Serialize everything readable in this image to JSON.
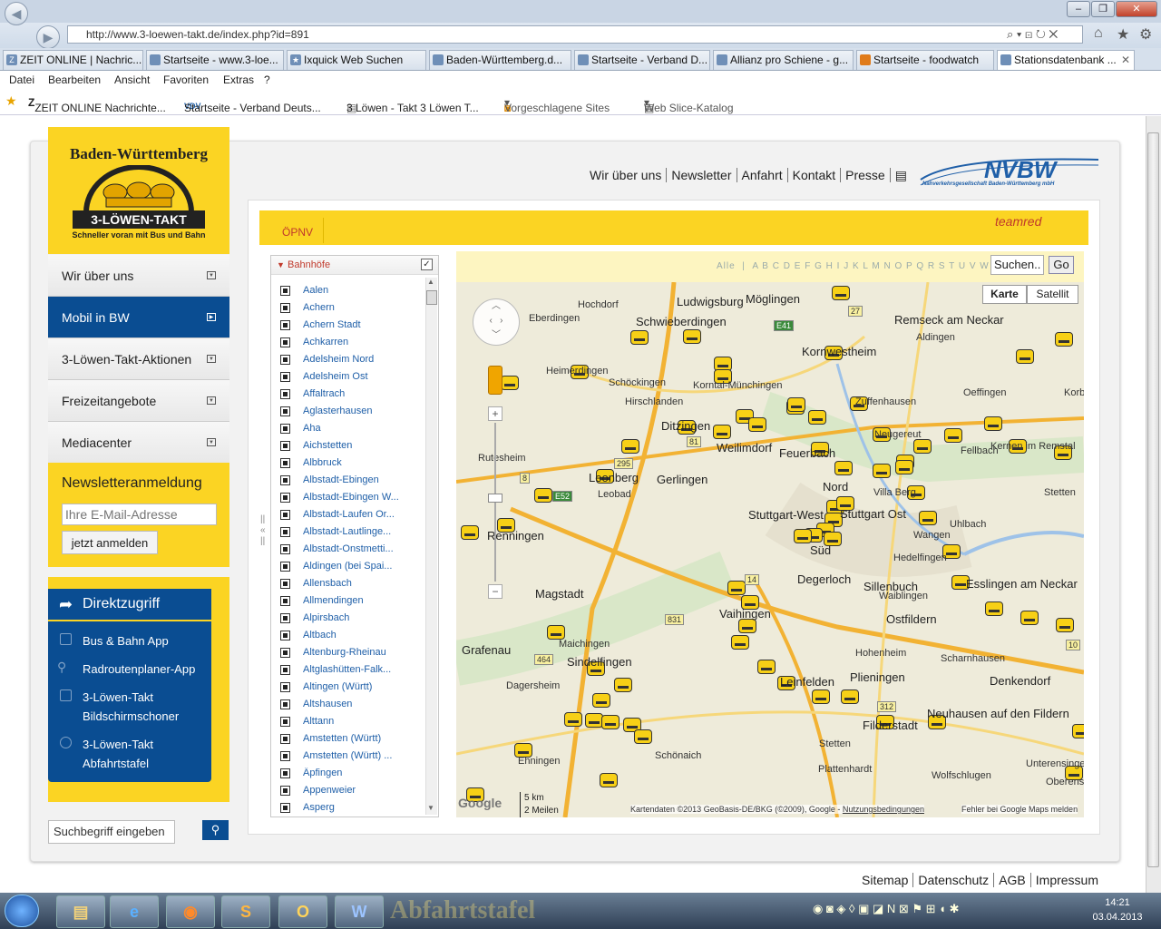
{
  "browser": {
    "url": "http://www.3-loewen-takt.de/index.php?id=891",
    "tabs": [
      {
        "label": "ZEIT ONLINE | Nachric...",
        "icon": "zeit-icon"
      },
      {
        "label": "Startseite - www.3-loe...",
        "icon": "page-icon"
      },
      {
        "label": "Ixquick Web Suchen",
        "icon": "star-icon"
      },
      {
        "label": "Baden-Württemberg.d...",
        "icon": "page-icon"
      },
      {
        "label": "Startseite - Verband D...",
        "icon": "vdv-icon"
      },
      {
        "label": "Allianz pro Schiene - g...",
        "icon": "page-icon"
      },
      {
        "label": "Startseite - foodwatch",
        "icon": "page-icon"
      },
      {
        "label": "Stationsdatenbank ...",
        "icon": "page-icon",
        "active": true
      }
    ],
    "menu": [
      "Datei",
      "Bearbeiten",
      "Ansicht",
      "Favoriten",
      "Extras",
      "?"
    ],
    "favorites": [
      "ZEIT ONLINE  Nachrichte...",
      "Startseite - Verband Deuts...",
      "3 Löwen - Takt 3 Löwen T...",
      "Vorgeschlagene Sites",
      "Web Slice-Katalog"
    ],
    "window_buttons": [
      "–",
      "❐",
      "✕"
    ]
  },
  "logo": {
    "region": "Baden-Württemberg",
    "name": "3-LÖWEN-TAKT",
    "tagline": "Schneller voran mit Bus und Bahn"
  },
  "topnav": [
    "Wir über uns",
    "Newsletter",
    "Anfahrt",
    "Kontakt",
    "Presse"
  ],
  "nvbw": {
    "name": "NVBW",
    "sub": "Nahverkehrsgesellschaft Baden-Württemberg mbH"
  },
  "sidebar": [
    {
      "label": "Wir über uns",
      "active": false
    },
    {
      "label": "Mobil in BW",
      "active": true
    },
    {
      "label": "3-Löwen-Takt-Aktionen",
      "active": false
    },
    {
      "label": "Freizeitangebote",
      "active": false
    },
    {
      "label": "Mediacenter",
      "active": false
    }
  ],
  "newsletter": {
    "title": "Newsletteranmeldung",
    "placeholder": "Ihre E-Mail-Adresse",
    "button": "jetzt anmelden"
  },
  "direkt": {
    "title": "Direktzugriff",
    "items": [
      {
        "line1": "Bus & Bahn App",
        "line2": ""
      },
      {
        "line1": "Radroutenplaner-App",
        "line2": ""
      },
      {
        "line1": "3-Löwen-Takt",
        "line2": "Bildschirmschoner"
      },
      {
        "line1": "3-Löwen-Takt",
        "line2": "Abfahrtstafel"
      }
    ]
  },
  "sitesearch": {
    "placeholder": "Suchbegriff eingeben"
  },
  "content": {
    "tab": "ÖPNV",
    "brand": "teamred"
  },
  "stations": {
    "header": "Bahnhöfe",
    "items": [
      "Aalen",
      "Achern",
      "Achern Stadt",
      "Achkarren",
      "Adelsheim Nord",
      "Adelsheim Ost",
      "Affaltrach",
      "Aglasterhausen",
      "Aha",
      "Aichstetten",
      "Albbruck",
      "Albstadt-Ebingen",
      "Albstadt-Ebingen W...",
      "Albstadt-Laufen Or...",
      "Albstadt-Lautlinge...",
      "Albstadt-Onstmetti...",
      "Aldingen (bei Spai...",
      "Allensbach",
      "Allmendingen",
      "Alpirsbach",
      "Altbach",
      "Altenburg-Rheinau",
      "Altglashütten-Falk...",
      "Altingen (Württ)",
      "Altshausen",
      "Alttann",
      "Amstetten (Württ)",
      "Amstetten (Württ) ...",
      "Äpfingen",
      "Appenweier",
      "Asperg"
    ]
  },
  "map": {
    "alpha_all": "Alle",
    "alphabet": "A B C D E F G H I J K L M N O P Q R S T U V W X Y Z",
    "search_placeholder": "Suchen...",
    "search_value": "Suchen..",
    "go": "Go",
    "types": [
      "Karte",
      "Satellit"
    ],
    "scale_km": "5 km",
    "scale_mi": "2 Meilen",
    "attribution": "Kartendaten ©2013 GeoBasis-DE/BKG (©2009), Google - ",
    "terms": "Nutzungsbedingungen",
    "report": "Fehler bei Google Maps melden",
    "places": [
      "Ludwigsburg",
      "Möglingen",
      "Hochdorf",
      "Eberdingen",
      "Schwieberdingen",
      "Remseck am Neckar",
      "Aldingen",
      "Kornwestheim",
      "Heimerdingen",
      "Schöckingen",
      "Hirschlanden",
      "Korntal-Münchingen",
      "Zuffenhausen",
      "Oeffingen",
      "Ditzingen",
      "Weilimdorf",
      "Feuerbach",
      "Neugereut",
      "Rutesheim",
      "Gerlingen",
      "Leonberg",
      "Leobad",
      "Nord",
      "Villa Berg",
      "Stuttgart-West",
      "Stuttgart Ost",
      "Renningen",
      "Süd",
      "Wangen",
      "Uhlbach",
      "Stetten",
      "Hedelfingen",
      "Magstadt",
      "Degerloch",
      "Sillenbuch",
      "Esslingen am Neckar",
      "Vaihingen",
      "Ostfildern",
      "Maichingen",
      "Grafenau",
      "Sindelfingen",
      "Leinfelden",
      "Plieningen",
      "Hohenheim",
      "Scharnhausen",
      "Denkendorf",
      "Dagersheim",
      "Filderstadt",
      "Neuhausen auf den Fildern",
      "Ehningen",
      "Schönaich",
      "Stetten",
      "Plattenhardt",
      "Wolfschlugen",
      "Unterensingen",
      "Oberensingen",
      "Kernen im Remstal",
      "Korb",
      "Fellbach",
      "Waiblingen"
    ],
    "roads": [
      "E41",
      "27",
      "8",
      "295",
      "E52",
      "81",
      "14",
      "831",
      "464",
      "312",
      "10"
    ]
  },
  "footer": [
    "Sitemap",
    "Datenschutz",
    "AGB",
    "Impressum"
  ],
  "taskbar": {
    "time": "14:21",
    "date": "03.04.2013",
    "programs": [
      "explorer-icon",
      "ie-icon",
      "firefox-icon",
      "s-icon",
      "outlook-icon",
      "word-icon"
    ],
    "active_title": "Abfahrtstafel"
  }
}
